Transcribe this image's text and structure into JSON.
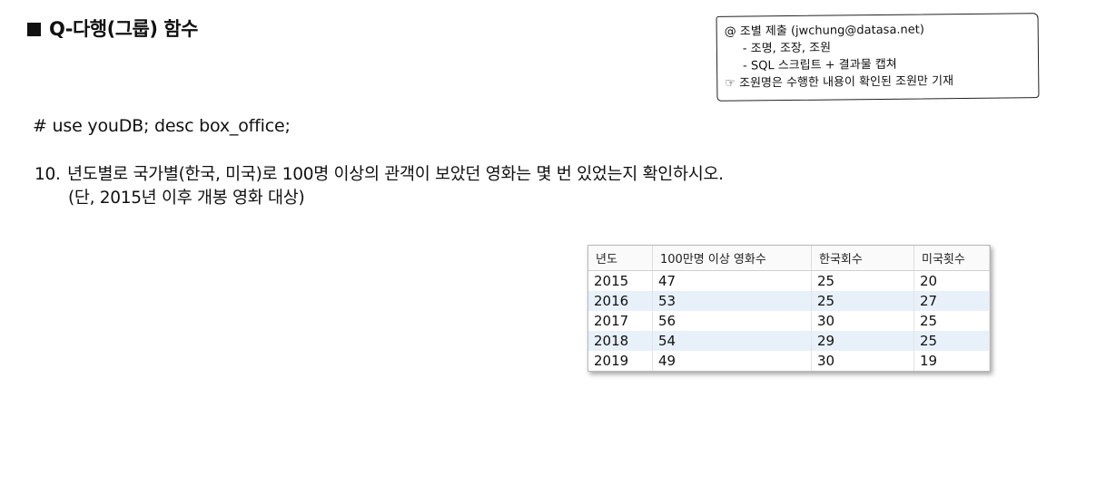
{
  "title": "Q-다행(그룹) 함수",
  "note": {
    "line1": "@ 조별 제출 (jwchung@datasa.net)",
    "line2": "- 조명, 조장, 조원",
    "line3": "- SQL 스크립트 + 결과물 캡쳐",
    "line4": "☞ 조원명은 수행한 내용이 확인된 조원만 기재"
  },
  "command": "# use youDB; desc box_office;",
  "question": {
    "number": "10.",
    "text": "년도별로 국가별(한국, 미국)로 100명 이상의 관객이 보았던 영화는 몇 번 있었는지 확인하시오.",
    "condition": "(단, 2015년 이후 개봉 영화 대상)"
  },
  "result": {
    "headers": [
      "년도",
      "100만명 이상 영화수",
      "한국회수",
      "미국횟수"
    ],
    "rows": [
      [
        "2015",
        "47",
        "25",
        "20"
      ],
      [
        "2016",
        "53",
        "25",
        "27"
      ],
      [
        "2017",
        "56",
        "30",
        "25"
      ],
      [
        "2018",
        "54",
        "29",
        "25"
      ],
      [
        "2019",
        "49",
        "30",
        "19"
      ]
    ]
  }
}
